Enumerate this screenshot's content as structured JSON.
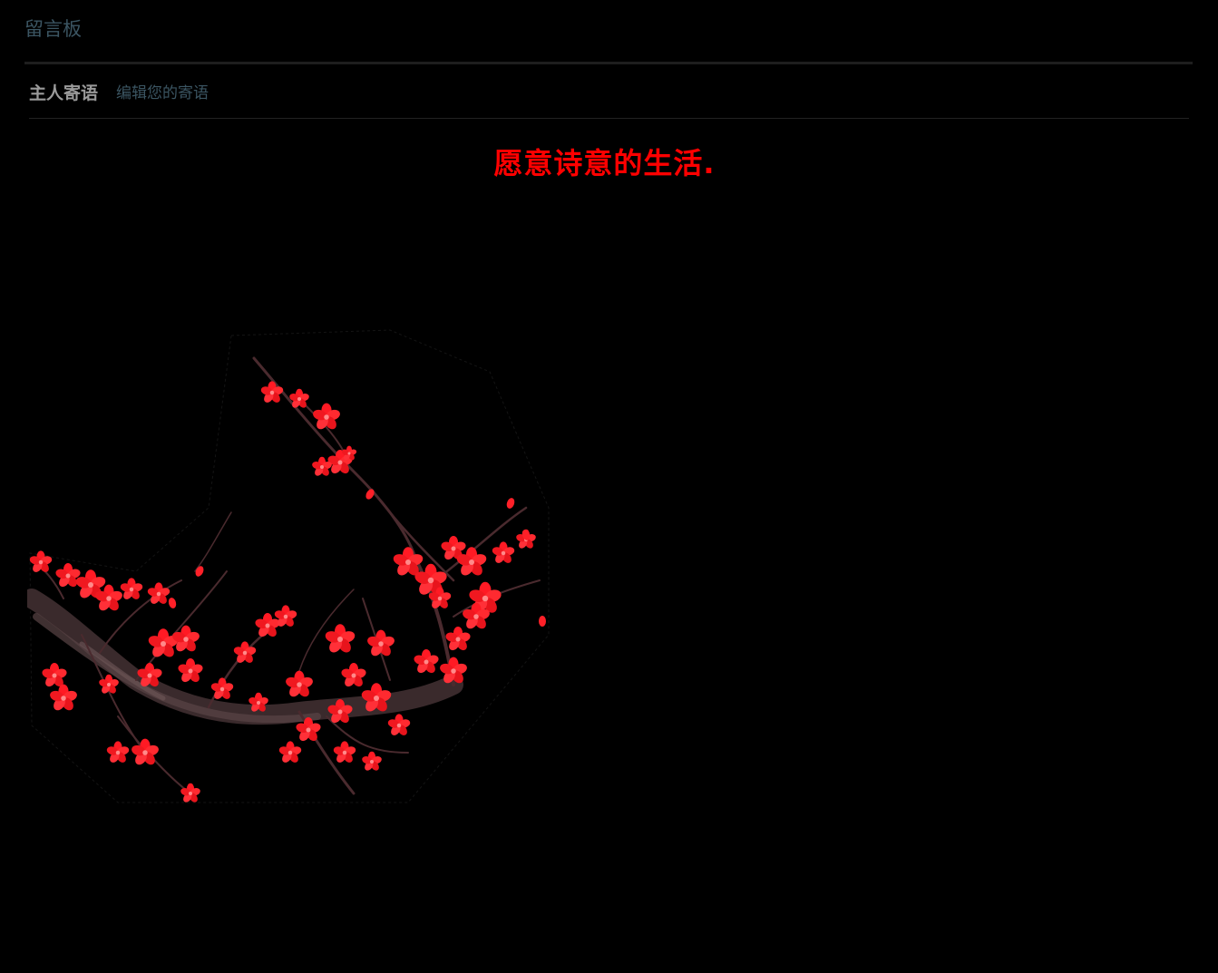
{
  "board": {
    "title": "留言板"
  },
  "tabs": {
    "host_message_label": "主人寄语",
    "edit_link_label": "编辑您的寄语"
  },
  "host_message": {
    "text": "愿意诗意的生活.",
    "color": "#ff0000"
  },
  "decoration": {
    "icon": "plum-blossom-branch"
  },
  "colors": {
    "background": "#000000",
    "link": "#3b5562",
    "label": "#9a9a9a"
  }
}
